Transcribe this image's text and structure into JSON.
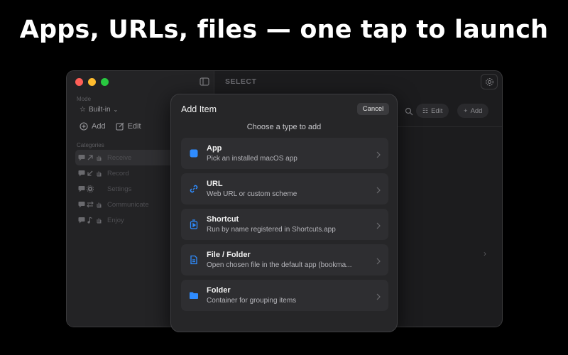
{
  "headline": "Apps, URLs, files — one tap to launch",
  "window": {
    "mode_label": "Mode",
    "mode_value": "Built-in",
    "sidebar_add": "Add",
    "sidebar_edit": "Edit",
    "categories_label": "Categories",
    "categories": [
      {
        "label": "Receive",
        "icons": [
          "message-icon",
          "arrow-up-right-icon",
          "hand-icon"
        ],
        "active": true
      },
      {
        "label": "Record",
        "icons": [
          "message-icon",
          "arrow-down-left-icon",
          "hand-icon"
        ],
        "active": false
      },
      {
        "label": "Settings",
        "icons": [
          "message-icon",
          "gear-icon"
        ],
        "active": false
      },
      {
        "label": "Communicate",
        "icons": [
          "message-icon",
          "arrows-swap-icon",
          "hand-icon"
        ],
        "active": false
      },
      {
        "label": "Enjoy",
        "icons": [
          "message-icon",
          "music-note-icon",
          "hand-icon"
        ],
        "active": false
      }
    ],
    "content_title": "SELECT",
    "toolbar_edit": "Edit",
    "toolbar_add": "Add"
  },
  "modal": {
    "title": "Add Item",
    "cancel": "Cancel",
    "subtitle": "Choose a type to add",
    "accent": "#2f8cff",
    "types": [
      {
        "name": "App",
        "desc": "Pick an installed macOS app",
        "icon": "app-square-icon"
      },
      {
        "name": "URL",
        "desc": "Web URL or custom scheme",
        "icon": "link-icon"
      },
      {
        "name": "Shortcut",
        "desc": "Run by name registered in Shortcuts.app",
        "icon": "shortcut-icon"
      },
      {
        "name": "File / Folder",
        "desc": "Open chosen file in the default app (bookma...",
        "icon": "document-icon"
      },
      {
        "name": "Folder",
        "desc": "Container for grouping items",
        "icon": "folder-icon"
      }
    ]
  }
}
